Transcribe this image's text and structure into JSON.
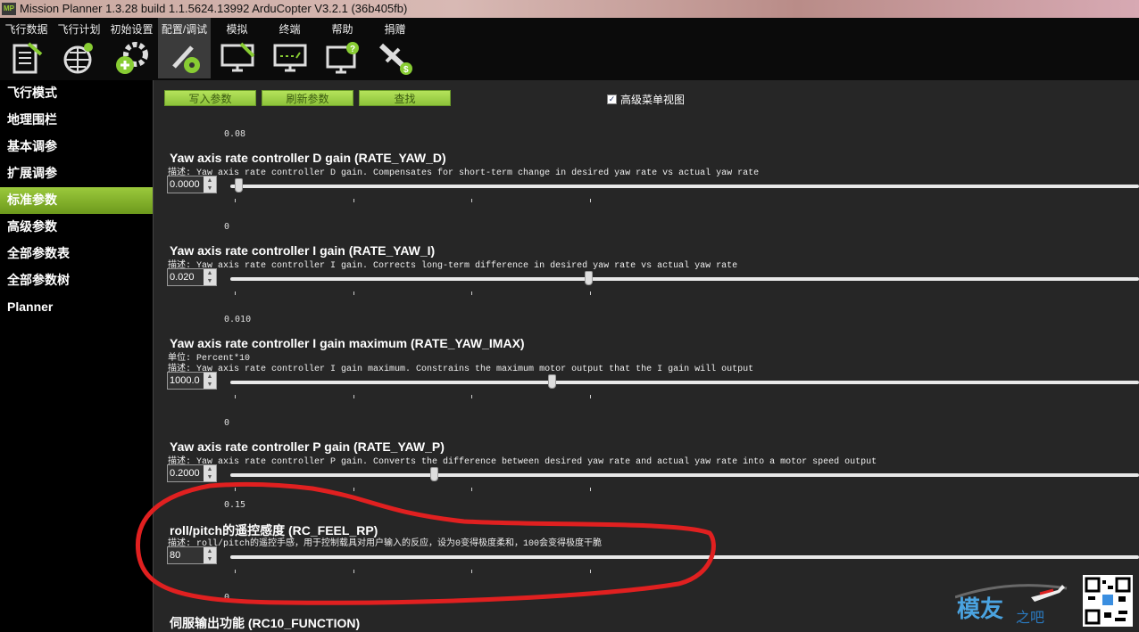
{
  "window": {
    "title": "Mission Planner 1.3.28 build 1.1.5624.13992 ArduCopter V3.2.1 (36b405fb)",
    "app_icon": "MP"
  },
  "toolbar": [
    {
      "label": "飞行数据",
      "icon": "flight-data-icon"
    },
    {
      "label": "飞行计划",
      "icon": "flight-plan-icon"
    },
    {
      "label": "初始设置",
      "icon": "initial-setup-icon"
    },
    {
      "label": "配置/调试",
      "icon": "config-tuning-icon",
      "active": true
    },
    {
      "label": "模拟",
      "icon": "simulation-icon"
    },
    {
      "label": "终端",
      "icon": "terminal-icon"
    },
    {
      "label": "帮助",
      "icon": "help-icon"
    },
    {
      "label": "捐赠",
      "icon": "donate-icon"
    }
  ],
  "sidebar": {
    "items": [
      {
        "label": "飞行模式"
      },
      {
        "label": "地理围栏"
      },
      {
        "label": "基本调参"
      },
      {
        "label": "扩展调参"
      },
      {
        "label": "标准参数",
        "active": true
      },
      {
        "label": "高级参数"
      },
      {
        "label": "全部参数表"
      },
      {
        "label": "全部参数树"
      },
      {
        "label": "Planner"
      }
    ]
  },
  "actions": {
    "write": "写入参数",
    "refresh": "刷新参数",
    "find": "查找",
    "advanced_view": "高级菜单视图",
    "advanced_checked": true
  },
  "params": [
    {
      "default": "0.08",
      "title": "Yaw axis rate controller D gain (RATE_YAW_D)",
      "desc": "描述: Yaw axis rate controller D gain.  Compensates for short-term change in desired yaw rate vs actual yaw rate",
      "value": "0.0000",
      "slider": 0.005
    },
    {
      "default": "0",
      "title": "Yaw axis rate controller I gain (RATE_YAW_I)",
      "desc": "描述: Yaw axis rate controller I gain.  Corrects long-term difference in desired yaw rate vs actual yaw rate",
      "value": "0.020",
      "slider": 0.39
    },
    {
      "default": "0.010",
      "title": "Yaw axis rate controller I gain maximum (RATE_YAW_IMAX)",
      "unit": "单位: Percent*10",
      "desc": "描述: Yaw axis rate controller I gain maximum.  Constrains the maximum motor output that the I gain will output",
      "value": "1000.0",
      "slider": 0.35
    },
    {
      "default": "0",
      "title": "Yaw axis rate controller P gain (RATE_YAW_P)",
      "desc": "描述: Yaw axis rate controller P gain.  Converts the difference between desired yaw rate and actual yaw rate into a motor speed output",
      "value": "0.2000",
      "slider": 0.22
    },
    {
      "default": "0.15",
      "title": "roll/pitch的遥控感度 (RC_FEEL_RP)",
      "desc": "描述: roll/pitch的遥控手感，用于控制载具对用户输入的反应，设为0变得极度柔和，100会变得极度干脆",
      "value": "80"
    },
    {
      "default": "0",
      "title": "伺服输出功能 (RC10_FUNCTION)"
    }
  ],
  "watermark": {
    "logo_text": "模友之吧",
    "qr": "qr-code"
  },
  "colors": {
    "accent": "#8cc23a",
    "annotation": "#e02020"
  }
}
